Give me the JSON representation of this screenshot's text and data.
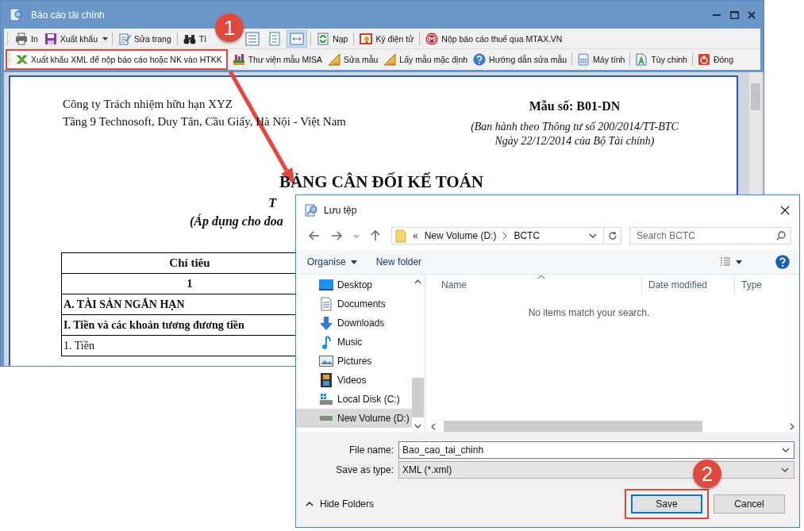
{
  "window": {
    "title": "Báo cáo tài chính"
  },
  "toolbar_row_1": [
    {
      "items": [
        {
          "kind": "button",
          "label": "In"
        },
        {
          "kind": "button",
          "label": "Xuất khẩu",
          "dropdown": true
        }
      ]
    },
    {
      "items": [
        {
          "kind": "button",
          "label": "Sửa trang"
        }
      ]
    },
    {
      "items": [
        {
          "kind": "button",
          "label": "Tì"
        },
        {
          "kind": "view",
          "selected": false
        },
        {
          "kind": "view",
          "selected": false
        },
        {
          "kind": "view",
          "selected": true
        }
      ]
    },
    {
      "items": [
        {
          "kind": "button",
          "label": "Nạp"
        }
      ]
    },
    {
      "items": [
        {
          "kind": "button",
          "label": "Ký điện tử"
        }
      ]
    },
    {
      "items": [
        {
          "kind": "button",
          "label": "Nộp báo cáo thuế qua MTAX.VN"
        }
      ]
    }
  ],
  "toolbar_row_2": [
    {
      "items": [
        {
          "label": "Xuất khẩu XML để nộp báo cáo hoặc NK vào HTKK",
          "highlighted": true
        },
        {
          "label": "Thư viện mẫu MISA",
          "highlighted": false
        },
        {
          "label": "Sửa mẫu",
          "highlighted": false
        },
        {
          "label": "Lấy mẫu mặc định",
          "highlighted": false
        },
        {
          "label": "Hướng dẫn sửa mẫu",
          "highlighted": false
        }
      ]
    },
    {
      "items": [
        {
          "label": "Máy tính",
          "highlighted": false
        }
      ]
    },
    {
      "items": [
        {
          "label": "Tùy chinh",
          "highlighted": false
        }
      ]
    },
    {
      "items": [
        {
          "label": "Đóng",
          "highlighted": false
        }
      ]
    }
  ],
  "document": {
    "company_lines": [
      "Công ty Trách nhiệm hữu hạn XYZ",
      "Tầng 9 Technosoft, Duy Tân, Cầu Giấy, Hà Nội - Việt Nam"
    ],
    "form_code": "Mẫu số: B01-DN",
    "form_notes": [
      "(Ban hành theo Thông tư số 200/2014/TT-BTC",
      "Ngày 22/12/2014 của Bộ Tài chính)"
    ],
    "title": "BẢNG CÂN ĐỐI KẾ TOÁN",
    "subtitle": "T",
    "scope_note": "(Áp dụng cho doa",
    "table_rows": [
      {
        "kind": "header",
        "text": "Chỉ tiêu"
      },
      {
        "kind": "header",
        "text": "1"
      },
      {
        "kind": "section",
        "text": "A. TÀI SẢN NGẮN HẠN"
      },
      {
        "kind": "section",
        "text": "I. Tiền và các khoản tương đương tiền"
      },
      {
        "kind": "item",
        "text": "1. Tiền"
      }
    ]
  },
  "dialog": {
    "title": "Lưu tệp",
    "address": {
      "overflow_mark": "«",
      "path": [
        "New Volume (D:)",
        "BCTC"
      ]
    },
    "search": {
      "placeholder": "Search BCTC"
    },
    "commands": [
      {
        "label": "Organise",
        "dropdown": true
      },
      {
        "label": "New folder",
        "dropdown": false
      }
    ],
    "nav_items": [
      {
        "label": "Desktop",
        "selected": false
      },
      {
        "label": "Documents",
        "selected": false
      },
      {
        "label": "Downloads",
        "selected": false
      },
      {
        "label": "Music",
        "selected": false
      },
      {
        "label": "Pictures",
        "selected": false
      },
      {
        "label": "Videos",
        "selected": false
      },
      {
        "label": "Local Disk (C:)",
        "selected": false
      },
      {
        "label": "New Volume (D:)",
        "selected": true
      }
    ],
    "columns": [
      "Name",
      "Date modified",
      "Type"
    ],
    "empty_message": "No items match your search.",
    "file_name": {
      "label": "File name:",
      "value": "Bao_cao_tai_chinh"
    },
    "save_type": {
      "label": "Save as type:",
      "value": "XML (*.xml)"
    },
    "hide_folders": "Hide Folders",
    "buttons": [
      {
        "label": "Save",
        "highlighted": true
      },
      {
        "label": "Cancel",
        "highlighted": false
      }
    ]
  },
  "annotations": [
    {
      "number": "1"
    },
    {
      "number": "2"
    }
  ]
}
